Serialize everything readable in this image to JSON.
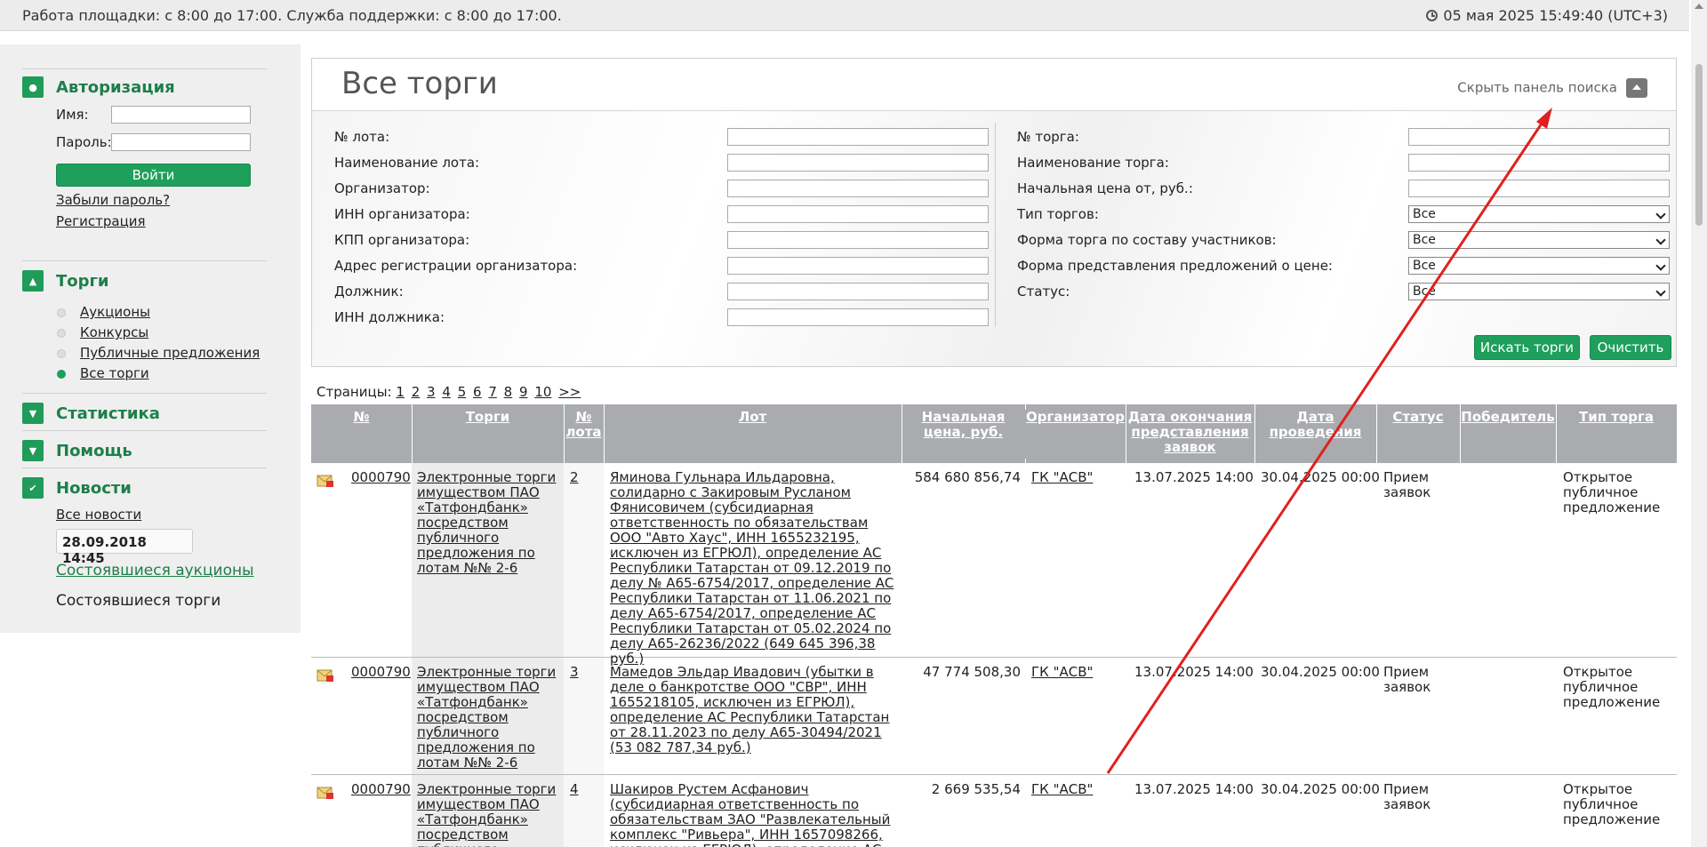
{
  "topbar": {
    "hours": "Работа площадки: с 8:00 до 17:00. Служба поддержки: с 8:00 до 17:00.",
    "datetime": "05 мая 2025 15:49:40 (UTC+3)"
  },
  "sidebar": {
    "auth": {
      "title": "Авторизация",
      "name_label": "Имя:",
      "password_label": "Пароль:",
      "login_button": "Войти",
      "forgot_link": "Забыли пароль?",
      "register_link": "Регистрация"
    },
    "torgi": {
      "title": "Торги",
      "items": [
        "Аукционы",
        "Конкурсы",
        "Публичные предложения",
        "Все торги"
      ]
    },
    "stats_title": "Статистика",
    "help_title": "Помощь",
    "news": {
      "title": "Новости",
      "all_news": "Все новости",
      "date": "28.09.2018 14:45",
      "link1": "Состоявшиеся аукционы",
      "link2": "Состоявшиеся торги"
    }
  },
  "panel": {
    "title": "Все торги",
    "hide_search": "Скрыть панель поиска",
    "left_fields": [
      "№ лота:",
      "Наименование лота:",
      "Организатор:",
      "ИНН организатора:",
      "КПП организатора:",
      "Адрес регистрации организатора:",
      "Должник:",
      "ИНН должника:"
    ],
    "right_fields": [
      "№ торга:",
      "Наименование торга:",
      "Начальная цена от, руб.:",
      "Тип торгов:",
      "Форма торга по составу участников:",
      "Форма представления предложений о цене:",
      "Статус:"
    ],
    "select_value": "Все",
    "search_button": "Искать торги",
    "clear_button": "Очистить"
  },
  "pagination": {
    "label": "Страницы:",
    "pages": [
      "1",
      "2",
      "3",
      "4",
      "5",
      "6",
      "7",
      "8",
      "9",
      "10",
      ">>"
    ]
  },
  "table": {
    "headers": [
      "№",
      "Торги",
      "№ лота",
      "Лот",
      "Начальная цена, руб.",
      "Организатор",
      "Дата окончания представления заявок",
      "Дата проведения",
      "Статус",
      "Победитель",
      "Тип торга"
    ],
    "rows": [
      {
        "num": "0000790",
        "torgi": "Электронные торги имуществом ПАО «Татфондбанк» посредством публичного предложения по лотам №№ 2-6",
        "lot_num": "2",
        "lot": "Яминова Гульнара Ильдаровна, солидарно с Закировым Русланом Фянисовичем (субсидиарная ответственность по обязательствам ООО \"Авто Хаус\", ИНН 1655232195, исключен из ЕГРЮЛ), определение АС Республики Татарстан от 09.12.2019 по делу № А65-6754/2017, определение АС Республики Татарстан от 11.06.2021 по делу А65-6754/2017, определение АС Республики Татарстан от 05.02.2024 по делу А65-26236/2022 (649 645 396,38 руб.)",
        "price": "584 680 856,74",
        "organizer": "ГК \"АСВ\"",
        "end_date": "13.07.2025 14:00",
        "date": "30.04.2025 00:00",
        "status": "Прием заявок",
        "winner": "",
        "type": "Открытое публичное предложение"
      },
      {
        "num": "0000790",
        "torgi": "Электронные торги имуществом ПАО «Татфондбанк» посредством публичного предложения по лотам №№ 2-6",
        "lot_num": "3",
        "lot": "Мамедов Эльдар Ивадович (убытки в деле о банкротстве ООО \"СВР\", ИНН 1655218105, исключен из ЕГРЮЛ), определение АС Республики Татарстан от 28.11.2023 по делу А65-30494/2021 (53 082 787,34 руб.)",
        "price": "47 774 508,30",
        "organizer": "ГК \"АСВ\"",
        "end_date": "13.07.2025 14:00",
        "date": "30.04.2025 00:00",
        "status": "Прием заявок",
        "winner": "",
        "type": "Открытое публичное предложение"
      },
      {
        "num": "0000790",
        "torgi": "Электронные торги имуществом ПАО «Татфондбанк» посредством публичного",
        "lot_num": "4",
        "lot": "Шакиров Рустем Асфанович (субсидиарная ответственность по обязательствам ЗАО \"Развлекательный комплекс \"Ривьера\", ИНН 1657098266, исключен из ЕГРЮЛ), определение АС Республики Татарстан от",
        "price": "2 669 535,54",
        "organizer": "ГК \"АСВ\"",
        "end_date": "13.07.2025 14:00",
        "date": "30.04.2025 00:00",
        "status": "Прием заявок",
        "winner": "",
        "type": "Открытое публичное предложение"
      }
    ]
  },
  "colors": {
    "accent": "#1e9f5c",
    "annotation_arrow": "#e02020",
    "table_header": "#a9abaf"
  }
}
